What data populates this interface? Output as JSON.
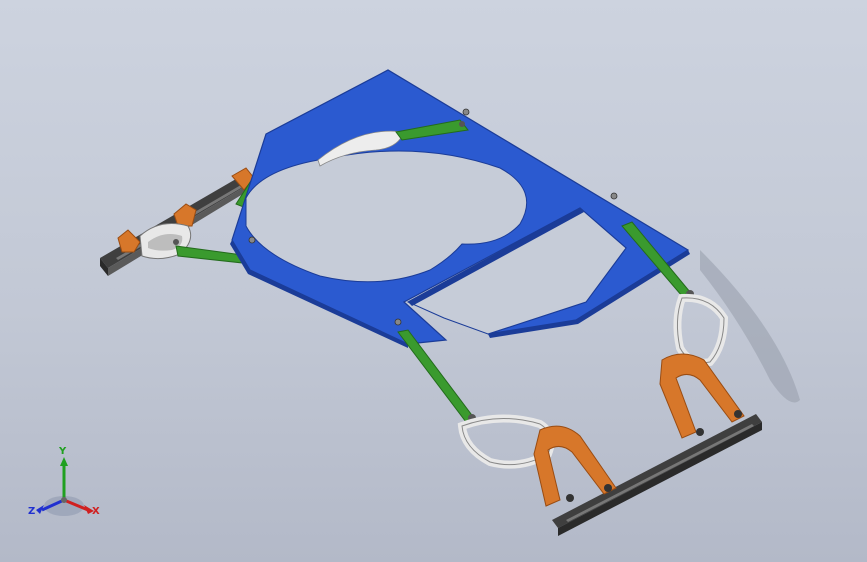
{
  "viewport": {
    "background_top": "#cdd3df",
    "background_bottom": "#b3b9c8"
  },
  "model": {
    "colors": {
      "plate": "#2b5ad0",
      "plate_edge": "#1b3c98",
      "link": "#3a9a2e",
      "link_dark": "#236b1c",
      "bracket": "#d7772a",
      "bracket_dark": "#9a4c12",
      "rail": "#4a4a4a",
      "silver": "#e6e6e6"
    }
  },
  "triad": {
    "labels": {
      "x": "X",
      "y": "Y",
      "z": "Z"
    },
    "colors": {
      "x": "#d02020",
      "y": "#20a020",
      "z": "#2030d0"
    }
  }
}
